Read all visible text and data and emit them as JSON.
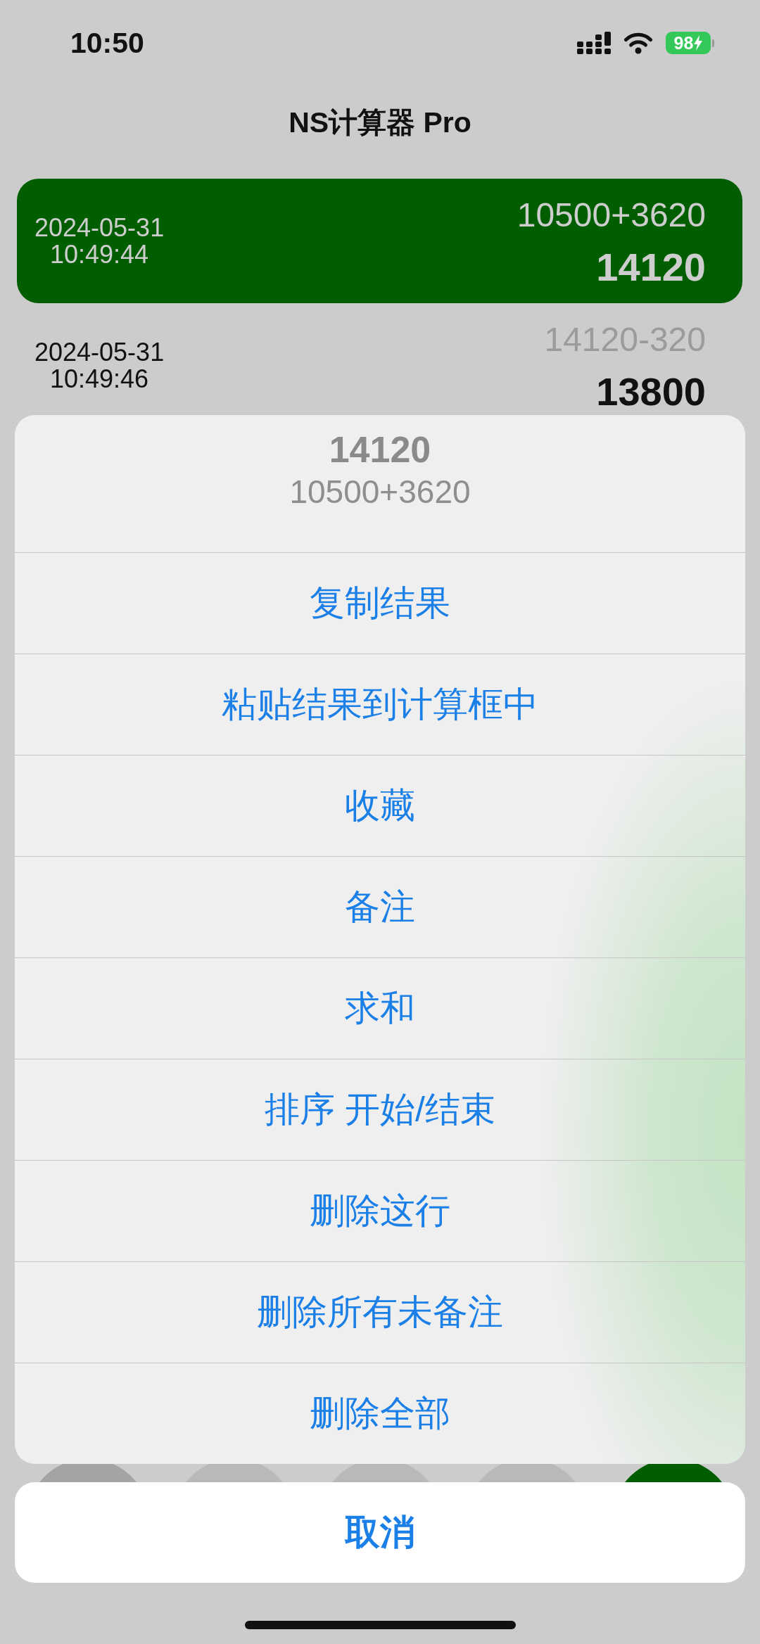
{
  "status_bar": {
    "time": "10:50",
    "battery": "98",
    "charging": true
  },
  "title": "NS计算器 Pro",
  "history": [
    {
      "date": "2024-05-31",
      "time": "10:49:44",
      "expression": "10500+3620",
      "result": "14120",
      "selected": true
    },
    {
      "date": "2024-05-31",
      "time": "10:49:46",
      "expression": "14120-320",
      "result": "13800",
      "selected": false
    }
  ],
  "action_sheet": {
    "title": "14120",
    "message": "10500+3620",
    "actions": [
      "复制结果",
      "粘贴结果到计算框中",
      "收藏",
      "备注",
      "求和",
      "排序 开始/结束",
      "删除这行",
      "删除所有未备注",
      "删除全部"
    ],
    "cancel": "取消"
  }
}
